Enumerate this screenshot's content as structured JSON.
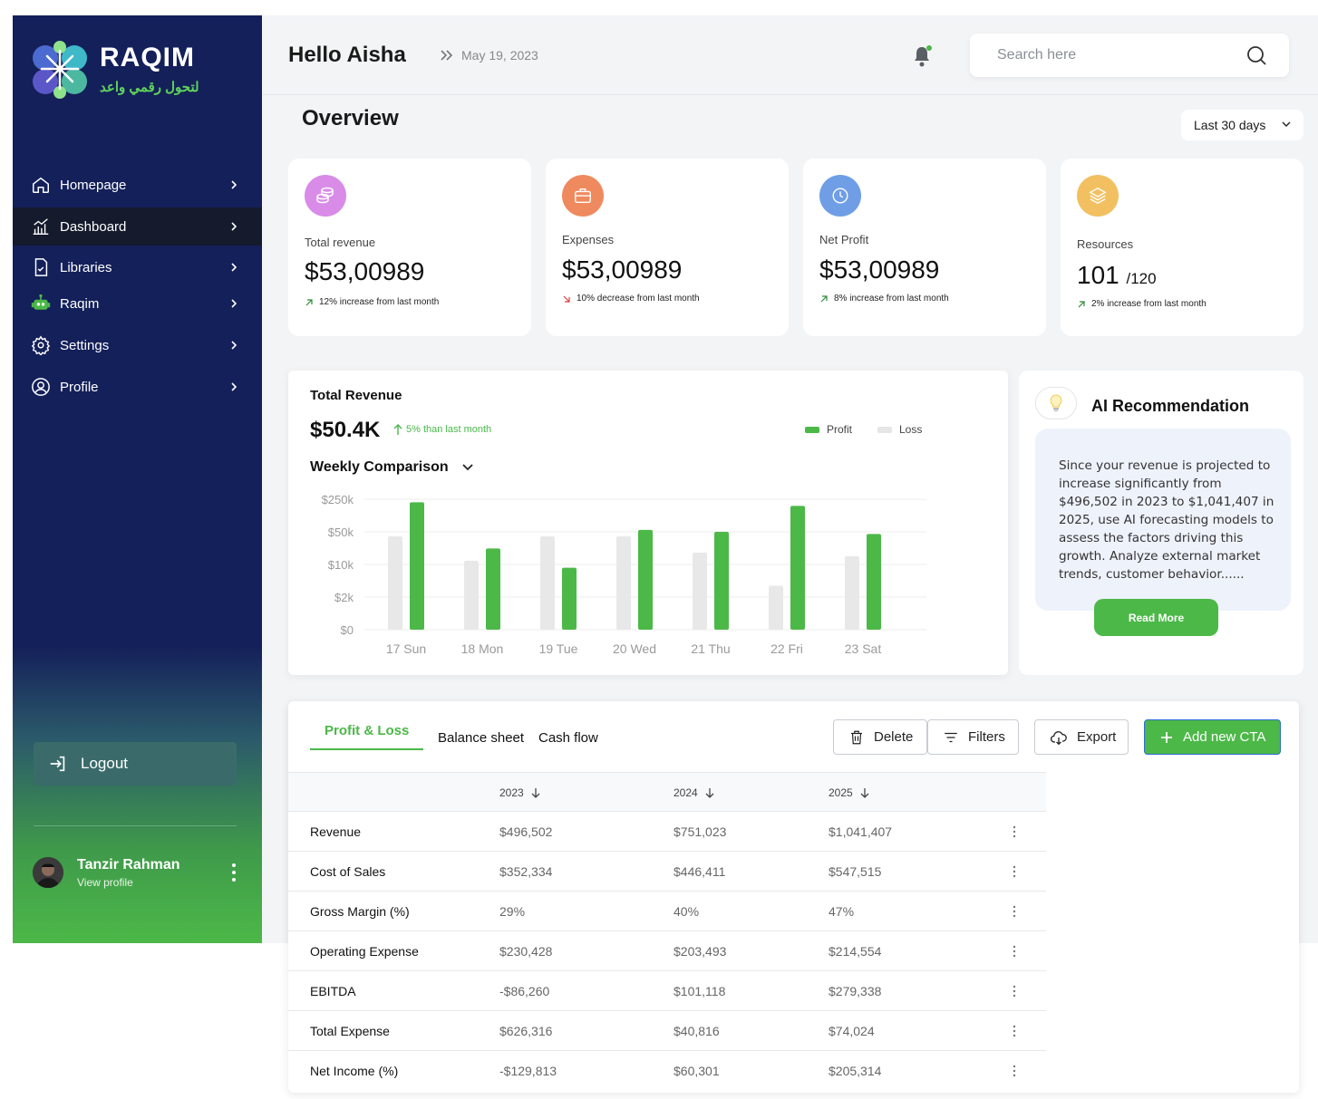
{
  "brand": {
    "name": "RAQIM",
    "tagline": "لتحول رقمي واعد"
  },
  "sidebar": {
    "items": [
      {
        "label": "Homepage",
        "icon": "home-icon"
      },
      {
        "label": "Dashboard",
        "icon": "chart-icon",
        "active": true
      },
      {
        "label": "Libraries",
        "icon": "file-icon"
      },
      {
        "label": "Raqim",
        "icon": "robot-icon"
      },
      {
        "label": "Settings",
        "icon": "gear-icon"
      },
      {
        "label": "Profile",
        "icon": "user-icon"
      }
    ],
    "logout": "Logout",
    "user": {
      "name": "Tanzir Rahman",
      "link": "View profile"
    }
  },
  "header": {
    "greeting": "Hello Aisha",
    "date": "May 19, 2023",
    "search_placeholder": "Search here"
  },
  "overview": {
    "title": "Overview",
    "range": "Last 30 days"
  },
  "stats": [
    {
      "label": "Total revenue",
      "value": "$53,00989",
      "delta": "12% increase from last month",
      "trend": "up",
      "color": "#d98be8"
    },
    {
      "label": "Expenses",
      "value": "$53,00989",
      "delta": "10% decrease from last month",
      "trend": "down",
      "color": "#ef8a5f"
    },
    {
      "label": "Net Profit",
      "value": "$53,00989",
      "delta": "8% increase from last month",
      "trend": "up",
      "color": "#6f9ee6"
    },
    {
      "label": "Resources",
      "value": "101",
      "value_suffix": "/120",
      "delta": "2% increase from last month",
      "trend": "up",
      "color": "#f2c061"
    }
  ],
  "revenue": {
    "title": "Total Revenue",
    "value": "$50.4K",
    "growth": "5% than last month",
    "subtitle": "Weekly Comparison",
    "legend": {
      "profit": "Profit",
      "loss": "Loss"
    }
  },
  "chart_data": {
    "type": "bar",
    "categories": [
      "17 Sun",
      "18 Mon",
      "19 Tue",
      "20 Wed",
      "21 Thu",
      "22 Fri",
      "23 Sat"
    ],
    "y_ticks": [
      "$250k",
      "$50k",
      "$10k",
      "$2k",
      "$0"
    ],
    "scale": "log",
    "series": [
      {
        "name": "Loss",
        "color": "#e8e8e8",
        "values": [
          40000,
          12000,
          40000,
          40000,
          18000,
          3500,
          15000
        ]
      },
      {
        "name": "Profit",
        "color": "#4cb848",
        "values": [
          215000,
          22000,
          8500,
          55000,
          50000,
          180000,
          45000
        ]
      }
    ],
    "grid": true,
    "legend_position": "top-right"
  },
  "ai": {
    "title": "AI Recommendation",
    "text": "Since your revenue is projected to increase significantly from $496,502 in 2023 to $1,041,407 in 2025, use AI forecasting models to assess the factors driving this growth. Analyze external market trends, customer behavior......",
    "button": "Read More"
  },
  "table": {
    "tabs": [
      "Profit & Loss",
      "Balance sheet",
      "Cash flow"
    ],
    "actions": {
      "delete": "Delete",
      "filters": "Filters",
      "export": "Export",
      "add": "Add new CTA"
    },
    "columns": [
      "2023",
      "2024",
      "2025"
    ],
    "rows": [
      {
        "label": "Revenue",
        "v": [
          "$496,502",
          "$751,023",
          "$1,041,407"
        ]
      },
      {
        "label": "Cost of Sales",
        "v": [
          "$352,334",
          "$446,411",
          "$547,515"
        ]
      },
      {
        "label": "Gross Margin (%)",
        "v": [
          "29%",
          "40%",
          "47%"
        ]
      },
      {
        "label": "Operating Expense",
        "v": [
          "$230,428",
          "$203,493",
          "$214,554"
        ]
      },
      {
        "label": "EBITDA",
        "v": [
          "-$86,260",
          "$101,118",
          "$279,338"
        ]
      },
      {
        "label": "Total Expense",
        "v": [
          "$626,316",
          "$40,816",
          "$74,024"
        ]
      },
      {
        "label": "Net Income (%)",
        "v": [
          "-$129,813",
          "$60,301",
          "$205,314"
        ]
      }
    ]
  }
}
